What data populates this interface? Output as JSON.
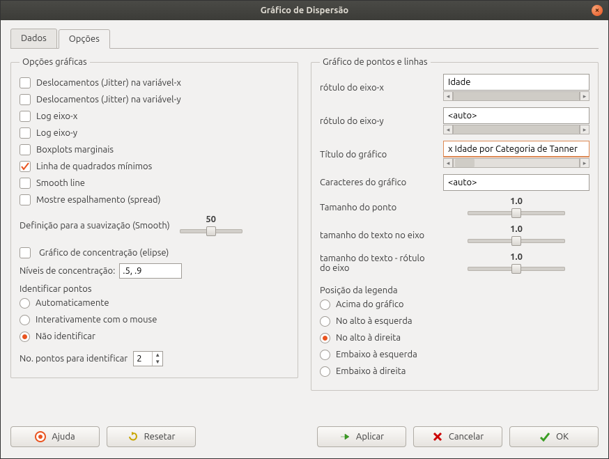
{
  "window": {
    "title": "Gráfico de Dispersão"
  },
  "tabs": {
    "dados": "Dados",
    "opcoes": "Opções"
  },
  "graphic_options": {
    "legend": "Opções gráficas",
    "jitter_x": "Deslocamentos (Jitter) na variável-x",
    "jitter_y": "Deslocamentos (Jitter) na variável-y",
    "log_x": "Log eixo-x",
    "log_y": "Log eixo-y",
    "box_marg": "Boxplots marginais",
    "lsline": "Linha de quadrados mínimos",
    "smooth_line": "Smooth line",
    "show_spread": "Mostre espalhamento (spread)",
    "smooth_def_label": "Definição para a suavização (Smooth)",
    "smooth_def_value": "50",
    "conc_ellipse": "Gráfico de concentração (elipse)",
    "conc_levels_label": "Níveis de concentração:",
    "conc_levels_value": ".5, .9",
    "identify_head": "Identificar pontos",
    "auto": "Automaticamente",
    "interactive": "Interativamente com o mouse",
    "none_id": "Não identificar",
    "npoints_label": "No. pontos para identificar",
    "npoints_value": "2"
  },
  "points_lines": {
    "legend": "Gráfico de pontos e linhas",
    "xlabel_lbl": "rótulo do eixo-x",
    "xlabel_val": "Idade",
    "ylabel_lbl": "rótulo do eixo-y",
    "ylabel_val": "<auto>",
    "title_lbl": "Título do gráfico",
    "title_val": "x Idade por Categoria de Tanner",
    "chars_lbl": "Caracteres do gráfico",
    "chars_val": "<auto>",
    "ptsize_lbl": "Tamanho do ponto",
    "ptsize_val": "1.0",
    "axistxt_lbl": "tamanho do texto no eixo",
    "axistxt_val": "1.0",
    "labtxt_lbl": "tamanho do texto - rótulo do eixo",
    "labtxt_val": "1.0",
    "legendpos_head": "Posição da legenda",
    "above": "Acima do gráfico",
    "topleft": "No alto à esquerda",
    "topright": "No alto à direita",
    "bottomleft": "Embaixo à esquerda",
    "bottomright": "Embaixo à direita"
  },
  "buttons": {
    "help": "Ajuda",
    "reset": "Resetar",
    "apply": "Aplicar",
    "cancel": "Cancelar",
    "ok": "OK"
  },
  "checks": {
    "jitter_x": false,
    "jitter_y": false,
    "log_x": false,
    "log_y": false,
    "box_marg": false,
    "lsline": true,
    "smooth_line": false,
    "show_spread": false,
    "conc_ellipse": false
  },
  "identify_selected": "none_id",
  "legend_selected": "topright"
}
